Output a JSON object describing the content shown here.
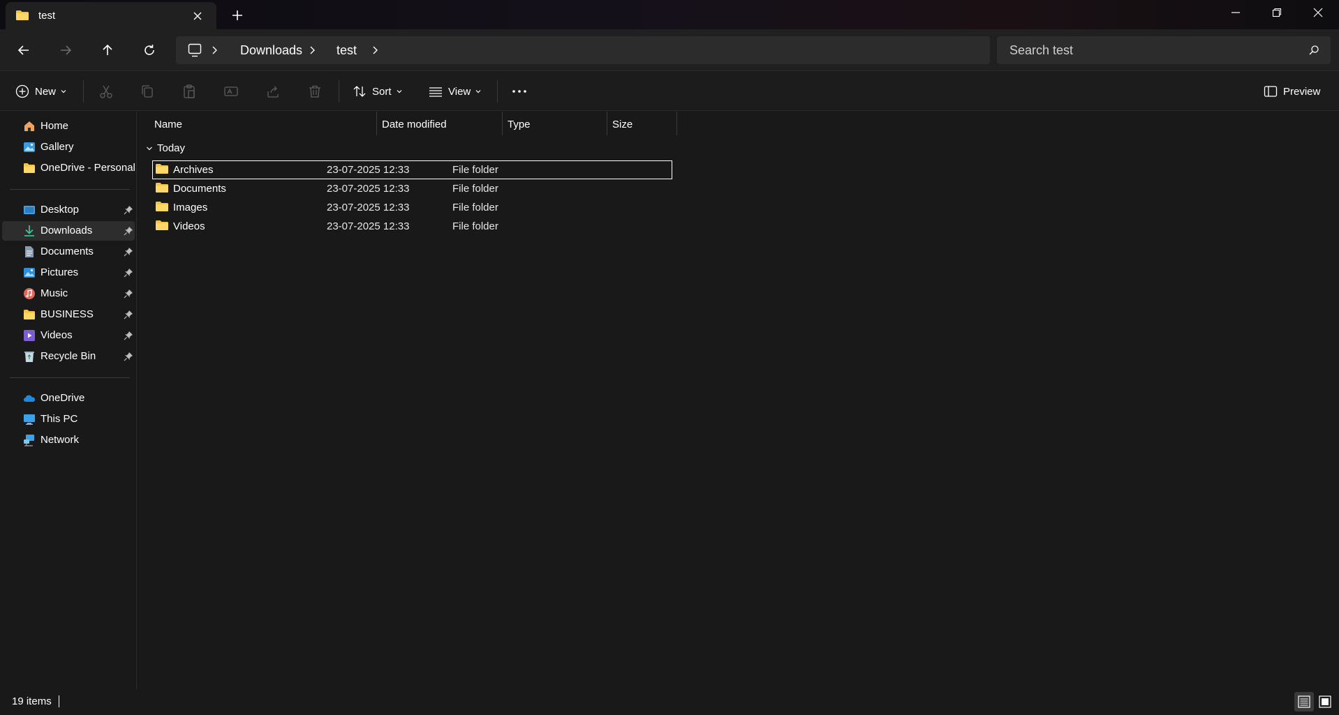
{
  "window": {
    "tab_title": "test",
    "tab_icon": "folder-icon",
    "new_tab_icon": "plus-icon",
    "controls": [
      "minimize-icon",
      "restore-icon",
      "close-icon"
    ]
  },
  "navigation": {
    "back_icon": "arrow-left-icon",
    "forward_icon": "arrow-right-icon",
    "up_icon": "arrow-up-icon",
    "refresh_icon": "refresh-icon",
    "breadcrumb": [
      "Downloads",
      "test"
    ],
    "search_placeholder": "Search test"
  },
  "commandbar": {
    "new_label": "New",
    "sort_label": "Sort",
    "view_label": "View",
    "preview_label": "Preview",
    "disabled_actions": [
      "cut-icon",
      "copy-icon",
      "paste-icon",
      "rename-icon",
      "share-icon",
      "delete-icon"
    ]
  },
  "sidebar": {
    "top_items": [
      {
        "label": "Home",
        "icon": "home-icon"
      },
      {
        "label": "Gallery",
        "icon": "gallery-icon"
      },
      {
        "label": "OneDrive - Personal",
        "icon": "folder-icon"
      }
    ],
    "pinned_items": [
      {
        "label": "Desktop",
        "icon": "desktop-icon"
      },
      {
        "label": "Downloads",
        "icon": "download-icon",
        "selected": true
      },
      {
        "label": "Documents",
        "icon": "document-icon"
      },
      {
        "label": "Pictures",
        "icon": "pictures-icon"
      },
      {
        "label": "Music",
        "icon": "music-icon"
      },
      {
        "label": "BUSINESS",
        "icon": "folder-icon"
      },
      {
        "label": "Videos",
        "icon": "videos-icon"
      },
      {
        "label": "Recycle Bin",
        "icon": "recycle-bin-icon"
      }
    ],
    "bottom_items": [
      {
        "label": "OneDrive",
        "icon": "cloud-icon"
      },
      {
        "label": "This PC",
        "icon": "pc-icon"
      },
      {
        "label": "Network",
        "icon": "network-icon"
      }
    ]
  },
  "filelist": {
    "columns": [
      "Name",
      "Date modified",
      "Type",
      "Size"
    ],
    "group": "Today",
    "rows": [
      {
        "name": "Archives",
        "date": "23-07-2025 12:33",
        "type": "File folder",
        "selected": true
      },
      {
        "name": "Documents",
        "date": "23-07-2025 12:33",
        "type": "File folder"
      },
      {
        "name": "Images",
        "date": "23-07-2025 12:33",
        "type": "File folder"
      },
      {
        "name": "Videos",
        "date": "23-07-2025 12:33",
        "type": "File folder"
      }
    ]
  },
  "status": {
    "item_count": "19 items",
    "view_mode": "details"
  },
  "colors": {
    "folder": "#f4c542",
    "background": "#191919",
    "selection": "#2d2d2d"
  }
}
